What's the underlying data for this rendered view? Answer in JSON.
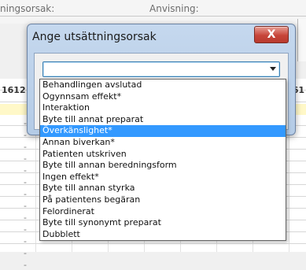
{
  "background": {
    "label_left": "ningsorsak:",
    "label_mid": "Anvisning:",
    "left_number": "1612",
    "right_number": "61",
    "rows": [
      "-",
      "-",
      "-",
      "-",
      "-",
      "-",
      "-",
      "-",
      "-",
      "-",
      "-",
      "-",
      "-"
    ]
  },
  "dialog": {
    "title": "Ange utsättningsorsak",
    "close_label": "X",
    "select_value": ""
  },
  "dropdown": {
    "options": [
      {
        "label": "Behandlingen avslutad",
        "selected": false
      },
      {
        "label": "Ogynnsam effekt*",
        "selected": false
      },
      {
        "label": "Interaktion",
        "selected": false
      },
      {
        "label": "Byte till annat preparat",
        "selected": false
      },
      {
        "label": "Överkänslighet*",
        "selected": true
      },
      {
        "label": "Annan biverkan*",
        "selected": false
      },
      {
        "label": "Patienten utskriven",
        "selected": false
      },
      {
        "label": "Byte till annan beredningsform",
        "selected": false
      },
      {
        "label": "Ingen effekt*",
        "selected": false
      },
      {
        "label": "Byte till annan styrka",
        "selected": false
      },
      {
        "label": "På patientens begäran",
        "selected": false
      },
      {
        "label": "Felordinerat",
        "selected": false
      },
      {
        "label": "Byte till synonymt preparat",
        "selected": false
      },
      {
        "label": "Dubblett",
        "selected": false
      }
    ]
  }
}
